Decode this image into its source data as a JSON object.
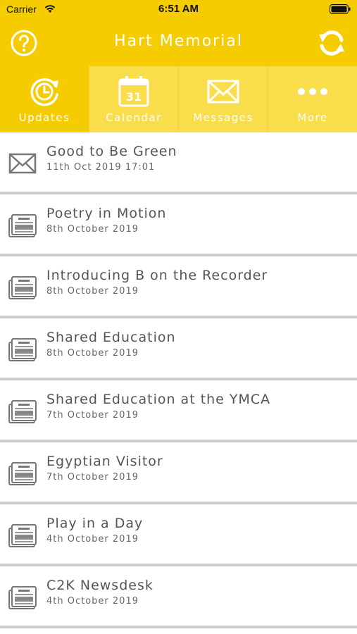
{
  "status_bar": {
    "carrier": "Carrier",
    "time": "6:51 AM"
  },
  "header": {
    "title": "Hart Memorial",
    "help_icon": "question-mark-icon",
    "refresh_icon": "refresh-icon"
  },
  "tabs": [
    {
      "label": "Updates",
      "icon": "clock-refresh-icon",
      "active": true
    },
    {
      "label": "Calendar",
      "icon": "calendar-icon",
      "calendar_day": "31",
      "active": false
    },
    {
      "label": "Messages",
      "icon": "envelope-icon",
      "active": false
    },
    {
      "label": "More",
      "icon": "ellipsis-icon",
      "active": false
    }
  ],
  "items": [
    {
      "title": "Good to Be Green",
      "date": "11th Oct 2019 17:01",
      "icon": "envelope-icon"
    },
    {
      "title": "Poetry in Motion",
      "date": "8th October 2019",
      "icon": "newspaper-icon"
    },
    {
      "title": "Introducing B on the Recorder",
      "date": "8th October 2019",
      "icon": "newspaper-icon"
    },
    {
      "title": "Shared Education",
      "date": "8th October 2019",
      "icon": "newspaper-icon"
    },
    {
      "title": "Shared Education at the YMCA",
      "date": "7th October 2019",
      "icon": "newspaper-icon"
    },
    {
      "title": "Egyptian Visitor",
      "date": "7th October 2019",
      "icon": "newspaper-icon"
    },
    {
      "title": "Play in a Day",
      "date": "4th October 2019",
      "icon": "newspaper-icon"
    },
    {
      "title": "C2K Newsdesk",
      "date": "4th October 2019",
      "icon": "newspaper-icon"
    }
  ],
  "colors": {
    "brand": "#f5cc00",
    "tab_inactive": "#f9dd4a",
    "divider": "#cfcfcf",
    "text": "#555555"
  }
}
